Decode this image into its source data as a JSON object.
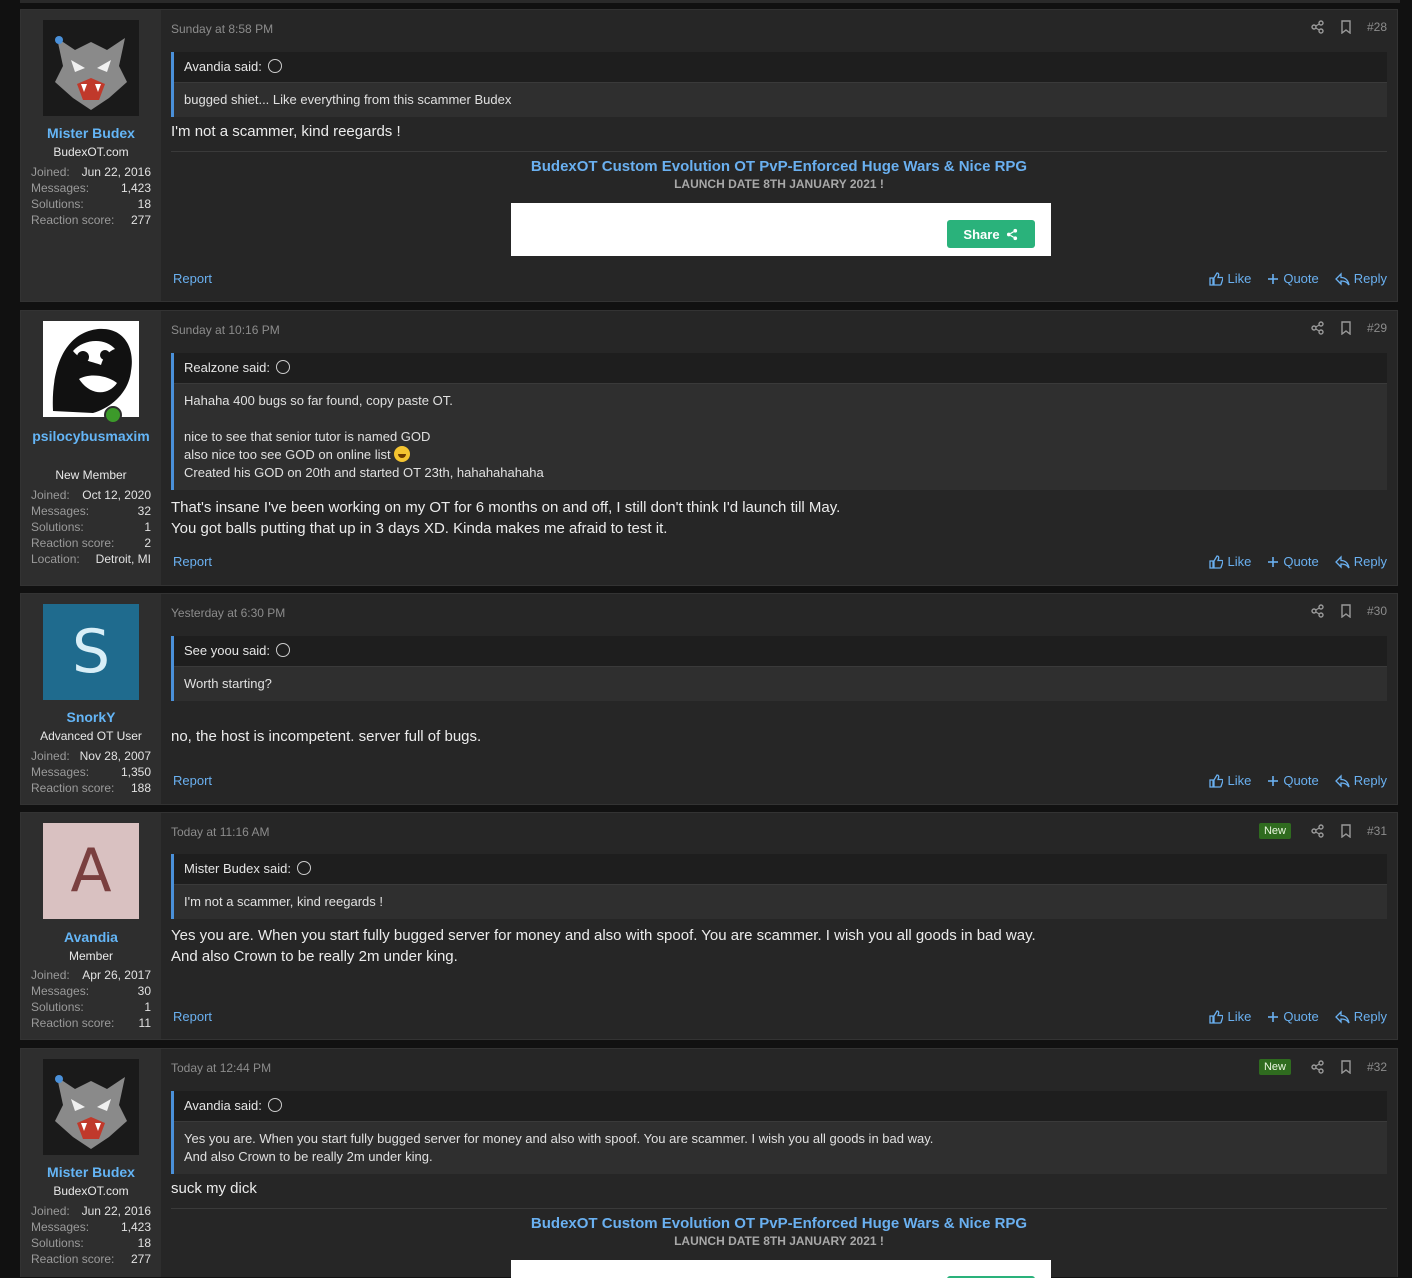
{
  "colors": {
    "accent": "#64b5f6",
    "new_badge": "#2f6b1f",
    "share_button": "#2ab27b"
  },
  "actions": {
    "report": "Report",
    "like": "Like",
    "quote": "Quote",
    "reply": "Reply",
    "new": "New",
    "said": "said:"
  },
  "signature": {
    "title": "BudexOT Custom Evolution OT PvP-Enforced Huge Wars & Nice RPG",
    "subtitle": "LAUNCH DATE 8TH JANUARY 2021 !",
    "share_label": "Share"
  },
  "posts": [
    {
      "time": "Sunday at 8:58 PM",
      "number": "#28",
      "user": {
        "name": "Mister Budex",
        "title": "BudexOT.com",
        "stats": [
          [
            "Joined:",
            "Jun 22, 2016"
          ],
          [
            "Messages:",
            "1,423"
          ],
          [
            "Solutions:",
            "18"
          ],
          [
            "Reaction score:",
            "277"
          ]
        ]
      },
      "quote_author": "Avandia",
      "quote_text": "bugged shiet... Like everything from this scammer Budex",
      "text": "I'm not a scammer, kind reegards !"
    },
    {
      "time": "Sunday at 10:16 PM",
      "number": "#29",
      "user": {
        "name": "psilocybusmaxim",
        "title": "New Member",
        "stats": [
          [
            "Joined:",
            "Oct 12, 2020"
          ],
          [
            "Messages:",
            "32"
          ],
          [
            "Solutions:",
            "1"
          ],
          [
            "Reaction score:",
            "2"
          ],
          [
            "Location:",
            "Detroit, MI"
          ]
        ]
      },
      "quote_author": "Realzone",
      "quote_lines": [
        "Hahaha 400 bugs so far found, copy paste OT.",
        "",
        "nice to see that senior tutor is named GOD",
        "also nice too see GOD on online list",
        "Created his GOD on 20th and started OT 23th, hahahahahaha"
      ],
      "text": "That's insane I've been working on my OT for 6 months on and off, I still don't think I'd launch till May.\nYou got balls putting that up in 3 days XD. Kinda makes me afraid to test it."
    },
    {
      "time": "Yesterday at 6:30 PM",
      "number": "#30",
      "user": {
        "name": "SnorkY",
        "title": "Advanced OT User",
        "initial": "S",
        "stats": [
          [
            "Joined:",
            "Nov 28, 2007"
          ],
          [
            "Messages:",
            "1,350"
          ],
          [
            "Reaction score:",
            "188"
          ]
        ]
      },
      "quote_author": "See yoou",
      "quote_text": "Worth starting?",
      "text": "no, the host is incompetent. server full of bugs."
    },
    {
      "time": "Today at 11:16 AM",
      "number": "#31",
      "user": {
        "name": "Avandia",
        "title": "Member",
        "initial": "A",
        "stats": [
          [
            "Joined:",
            "Apr 26, 2017"
          ],
          [
            "Messages:",
            "30"
          ],
          [
            "Solutions:",
            "1"
          ],
          [
            "Reaction score:",
            "11"
          ]
        ]
      },
      "quote_author": "Mister Budex",
      "quote_text": "I'm not a scammer, kind reegards !",
      "text": "Yes you are. When you start fully bugged server for money and also with spoof. You are scammer. I wish you all goods in bad way.\nAnd also Crown to be really 2m under king."
    },
    {
      "time": "Today at 12:44 PM",
      "number": "#32",
      "user": {
        "name": "Mister Budex",
        "title": "BudexOT.com",
        "stats": [
          [
            "Joined:",
            "Jun 22, 2016"
          ],
          [
            "Messages:",
            "1,423"
          ],
          [
            "Solutions:",
            "18"
          ],
          [
            "Reaction score:",
            "277"
          ]
        ]
      },
      "quote_author": "Avandia",
      "quote_text": "Yes you are. When you start fully bugged server for money and also with spoof. You are scammer. I wish you all goods in bad way.\nAnd also Crown to be really 2m under king.",
      "text": "suck my dick"
    }
  ]
}
